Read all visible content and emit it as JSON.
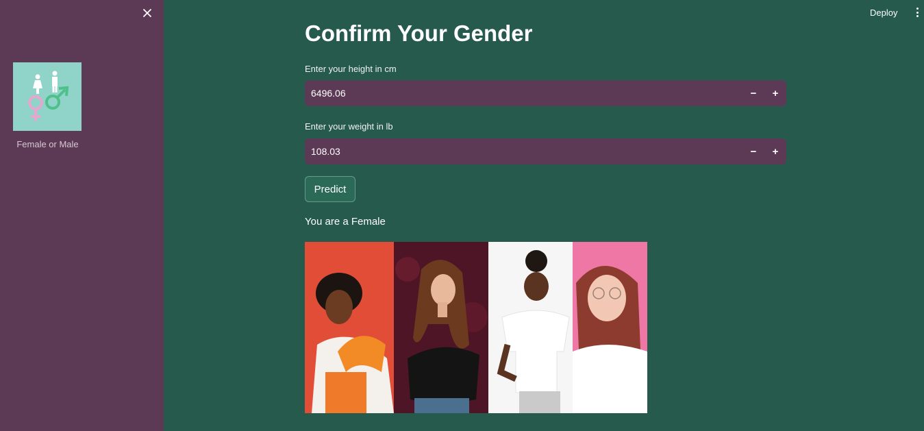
{
  "sidebar": {
    "close_label": "×",
    "logo_caption": "Female or Male"
  },
  "header": {
    "deploy_label": "Deploy"
  },
  "main": {
    "title": "Confirm Your Gender",
    "height_field": {
      "label": "Enter your height in cm",
      "value": "6496.06"
    },
    "weight_field": {
      "label": "Enter your weight in lb",
      "value": "108.03"
    },
    "stepper": {
      "minus": "−",
      "plus": "+"
    },
    "predict_label": "Predict",
    "result": "You are a Female"
  },
  "colors": {
    "background": "#255a4d",
    "sidebar": "#5c3a55",
    "input_background": "#5c3a55",
    "button_background": "#2c6a58"
  },
  "icons": [
    "close-icon",
    "kebab-menu-icon",
    "gender-symbols-icon",
    "minus-icon",
    "plus-icon"
  ]
}
